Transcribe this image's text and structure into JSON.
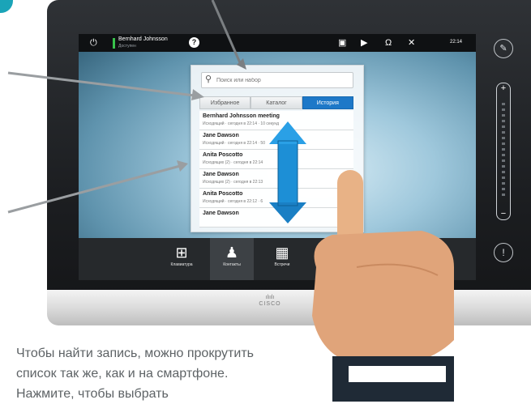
{
  "user": {
    "name": "Bernhard Johnsson",
    "status": "Доступен"
  },
  "topbar": {
    "time": "22:14",
    "help_label": "?"
  },
  "search": {
    "placeholder": "Поиск или набор"
  },
  "tabs": [
    {
      "label": "Избранное",
      "active": false
    },
    {
      "label": "Каталог",
      "active": false
    },
    {
      "label": "История",
      "active": true
    }
  ],
  "list": [
    {
      "title": "Bernhard Johnsson meeting",
      "subtitle": "Исходящий · сегодня в 22:14 · 10 секунд"
    },
    {
      "title": "Jane Dawson",
      "subtitle": "Исходящий · сегодня в 22:14 · 50"
    },
    {
      "title": "Anita Poscotto",
      "subtitle": "Исходящих (2) · сегодня в 22:14"
    },
    {
      "title": "Jane Dawson",
      "subtitle": "Исходящих (2) · сегодня в 22:13"
    },
    {
      "title": "Anita Poscotto",
      "subtitle": "Исходящий · сегодня в 22:12 · 6"
    },
    {
      "title": "Jane Dawson",
      "subtitle": ""
    }
  ],
  "bottom_nav": [
    {
      "label": "Клавиатура",
      "icon": "keypad-icon",
      "active": false
    },
    {
      "label": "Контакты",
      "icon": "contacts-icon",
      "active": true
    },
    {
      "label": "Встречи",
      "icon": "calendar-icon",
      "active": false
    }
  ],
  "brand": {
    "logo_text": "CISCO"
  },
  "caption": "Чтобы найти запись, можно прокрутить список так же, как и на смартфоне. Нажмите, чтобы выбрать",
  "colors": {
    "accent": "#1d78c8",
    "status_available": "#38c24b",
    "arrow": "#1d8fd6"
  }
}
